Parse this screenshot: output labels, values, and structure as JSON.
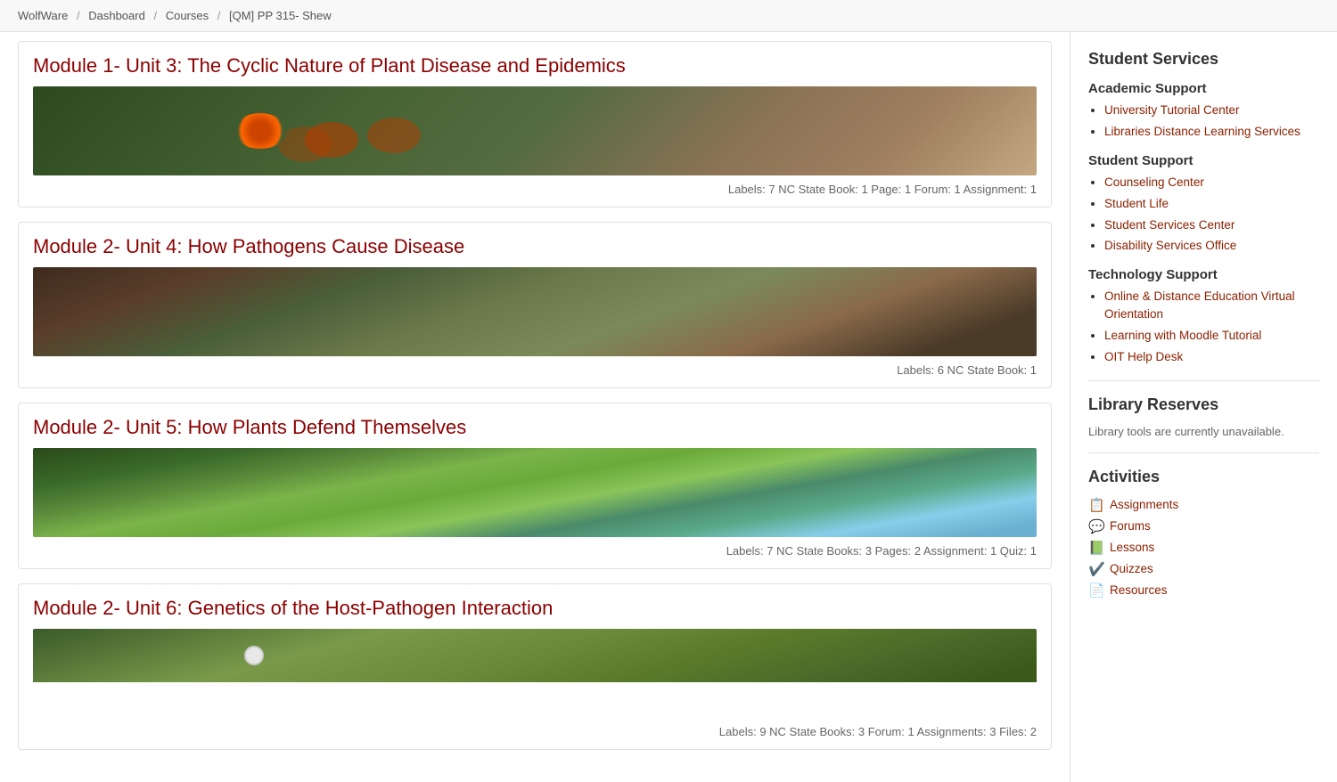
{
  "breadcrumb": {
    "items": [
      {
        "label": "WolfWare",
        "href": "#"
      },
      {
        "label": "Dashboard",
        "href": "#"
      },
      {
        "label": "Courses",
        "href": "#"
      },
      {
        "label": "[QM] PP 315- Shew",
        "href": "#"
      }
    ],
    "separators": [
      "/",
      "/",
      "/"
    ]
  },
  "modules": [
    {
      "id": "module1",
      "title": "Module 1- Unit 3: The Cyclic Nature of Plant Disease and Epidemics",
      "image_class": "img-module1",
      "labels": "Labels: 7  NC State Book: 1  Page: 1  Forum: 1  Assignment: 1"
    },
    {
      "id": "module2",
      "title": "Module 2- Unit 4: How Pathogens Cause Disease",
      "image_class": "img-module2",
      "labels": "Labels: 6  NC State Book: 1"
    },
    {
      "id": "module3",
      "title": "Module 2- Unit 5: How Plants Defend Themselves",
      "image_class": "img-module3",
      "labels": "Labels: 7  NC State Books: 3  Pages: 2  Assignment: 1  Quiz: 1"
    },
    {
      "id": "module4",
      "title": "Module 2- Unit 6: Genetics of the Host-Pathogen Interaction",
      "image_class": "img-module4",
      "labels": "Labels: 9  NC State Books: 3  Forum: 1  Assignments: 3  Files: 2"
    }
  ],
  "sidebar": {
    "student_services_title": "Student Services",
    "academic_support_title": "Academic Support",
    "academic_support_links": [
      {
        "label": "University Tutorial Center",
        "href": "#"
      },
      {
        "label": "Libraries Distance Learning Services",
        "href": "#"
      }
    ],
    "student_support_title": "Student Support",
    "student_support_links": [
      {
        "label": "Counseling Center",
        "href": "#"
      },
      {
        "label": "Student Life",
        "href": "#"
      },
      {
        "label": "Student Services Center",
        "href": "#"
      },
      {
        "label": "Disability Services Office",
        "href": "#"
      }
    ],
    "technology_support_title": "Technology Support",
    "technology_support_links": [
      {
        "label": "Online & Distance Education Virtual Orientation",
        "href": "#"
      },
      {
        "label": "Learning with Moodle Tutorial",
        "href": "#"
      },
      {
        "label": "OIT Help Desk",
        "href": "#"
      }
    ],
    "library_reserves_title": "Library Reserves",
    "library_reserves_text": "Library tools are currently unavailable.",
    "activities_title": "Activities",
    "activities": [
      {
        "label": "Assignments",
        "icon": "📋",
        "href": "#"
      },
      {
        "label": "Forums",
        "icon": "🗨",
        "href": "#"
      },
      {
        "label": "Lessons",
        "icon": "📗",
        "href": "#"
      },
      {
        "label": "Quizzes",
        "icon": "✔",
        "href": "#"
      },
      {
        "label": "Resources",
        "icon": "📄",
        "href": "#"
      }
    ]
  }
}
